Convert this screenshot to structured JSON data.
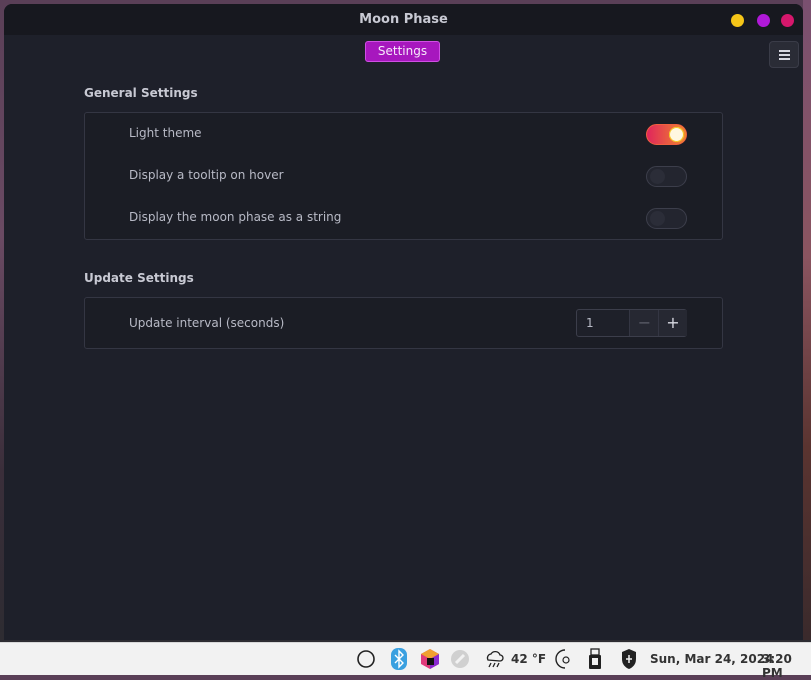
{
  "window": {
    "title": "Moon Phase"
  },
  "tabs": [
    {
      "label": "Settings"
    }
  ],
  "general": {
    "title": "General Settings",
    "rows": [
      {
        "label": "Light theme",
        "enabled": true
      },
      {
        "label": "Display a tooltip on hover",
        "enabled": false
      },
      {
        "label": "Display the moon phase as a string",
        "enabled": false
      }
    ]
  },
  "update": {
    "title": "Update Settings",
    "interval_label": "Update interval (seconds)",
    "interval_value": "1",
    "minus": "−",
    "plus": "+"
  },
  "taskbar": {
    "temperature": "42 °F",
    "date": "Sun, Mar 24, 2024",
    "time": "3:20 PM",
    "icons": [
      "circle-icon",
      "bluetooth-icon",
      "app-cube-icon",
      "link-icon",
      "weather-rain-icon",
      "night-light-icon",
      "usb-device-icon",
      "shield-icon"
    ]
  },
  "colors": {
    "accent": "#a717be",
    "window_bg": "#1e202a",
    "toggle_on": "#e0255c"
  }
}
